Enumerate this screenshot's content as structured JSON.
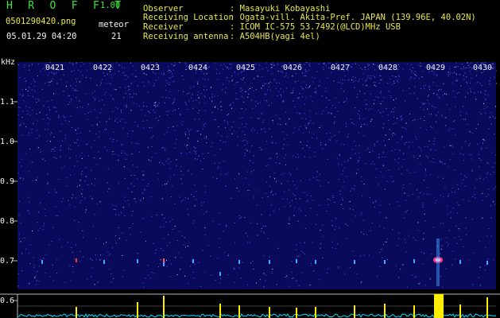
{
  "header": {
    "title": "H R O F F T",
    "version": "1.00",
    "filename": "0501290420.png",
    "datetime": "05.01.29 04:20",
    "meteor_label": "meteor",
    "meteor_count": "21"
  },
  "info": [
    {
      "key": "Observer",
      "value": ": Masayuki Kobayashi"
    },
    {
      "key": "Receiving Location",
      "value": ": Ogata-vill. Akita-Pref. JAPAN (139.96E, 40.02N)"
    },
    {
      "key": "Receiver",
      "value": ": ICOM IC-575 53.7492(@LCD)MHz USB"
    },
    {
      "key": "Receiving antenna",
      "value": ": A504HB(yagi 4el)"
    }
  ],
  "axis": {
    "unit": "kHz",
    "y_labels": [
      "1.1",
      "1.0",
      "0.9",
      "0.8",
      "0.7",
      "0.6"
    ],
    "time_labels": [
      "0421",
      "0422",
      "0423",
      "0424",
      "0425",
      "0426",
      "0427",
      "0428",
      "0429",
      "0430"
    ]
  },
  "colors": {
    "background": "#000000",
    "spectrogram_bg": "#0a0a5c",
    "noise": "#4a5cff",
    "grid": "#b8b8b8",
    "trace": "#00e0ff",
    "spike": "#ffee00",
    "title": "#39e639",
    "info_text": "#e8e84a"
  }
}
